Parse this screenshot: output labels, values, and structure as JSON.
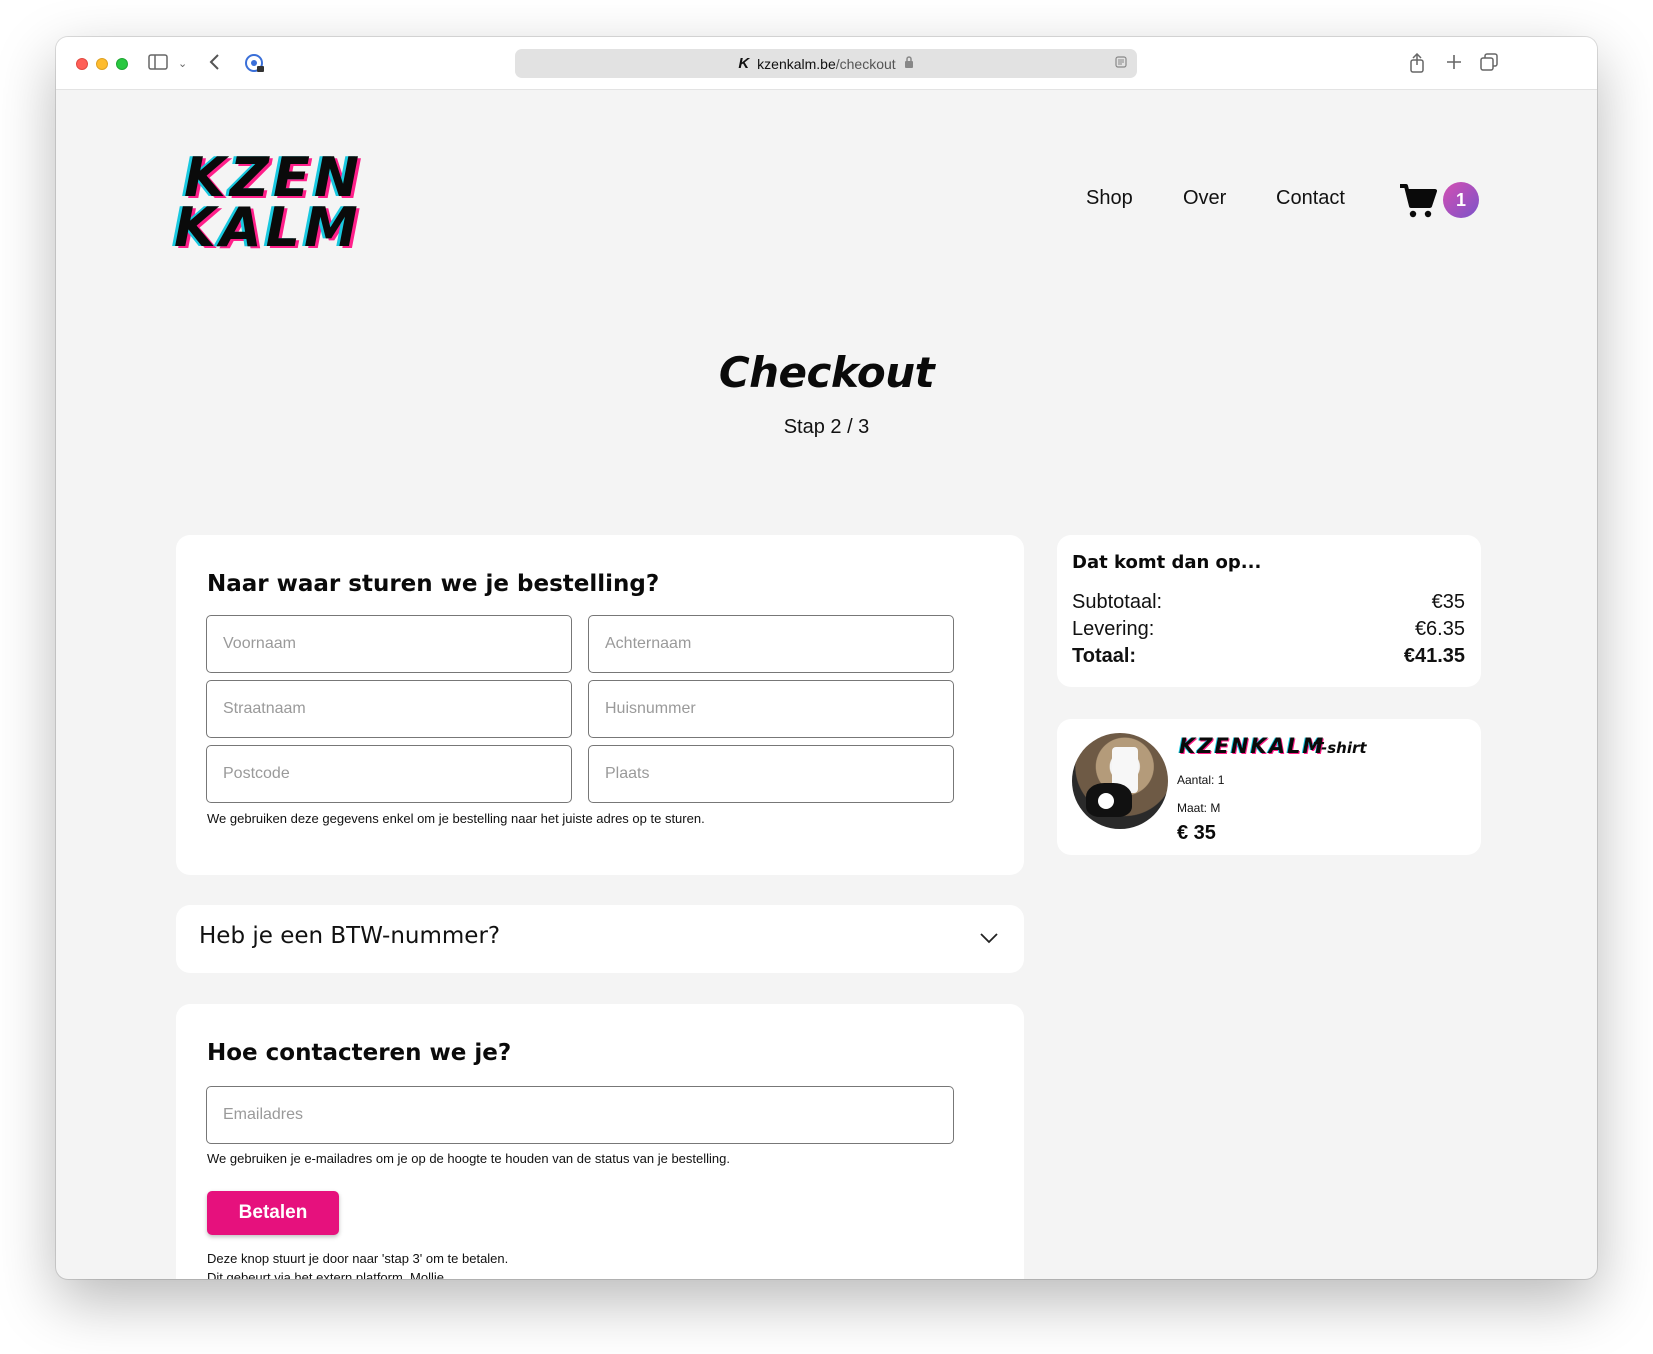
{
  "browser": {
    "domain": "kzenkalm.be",
    "path": "/checkout",
    "favicon_letter": "K"
  },
  "header": {
    "logo_line1": "KZEN",
    "logo_line2": "KALM",
    "nav": [
      "Shop",
      "Over",
      "Contact"
    ],
    "cart_count": "1"
  },
  "page": {
    "title": "Checkout",
    "step": "Stap 2 / 3"
  },
  "address": {
    "heading": "Naar waar sturen we je bestelling?",
    "fields": {
      "first_name": "Voornaam",
      "last_name": "Achternaam",
      "street": "Straatnaam",
      "house_number": "Huisnummer",
      "postcode": "Postcode",
      "city": "Plaats"
    },
    "helper": "We gebruiken deze gegevens enkel om je bestelling naar het juiste adres op te sturen."
  },
  "vat": {
    "label": "Heb je een BTW-nummer?"
  },
  "contact": {
    "heading": "Hoe contacteren we je?",
    "email_placeholder": "Emailadres",
    "helper": "We gebruiken je e-mailadres om je op de hoogte te houden van de status van je bestelling.",
    "pay_button": "Betalen",
    "note_line1": "Deze knop stuurt je door naar 'stap 3' om te betalen.",
    "note_line2": "Dit gebeurt via het extern platform, Mollie."
  },
  "summary": {
    "title": "Dat komt dan op...",
    "subtotal_label": "Subtotaal:",
    "subtotal_value": "€35",
    "delivery_label": "Levering:",
    "delivery_value": "€6.35",
    "total_label": "Totaal:",
    "total_value": "€41.35"
  },
  "product": {
    "name": "KZENKALM",
    "type": "T-shirt",
    "quantity": "Aantal: 1",
    "size": "Maat: M",
    "price": "€ 35"
  },
  "colors": {
    "accent": "#e6117d",
    "badge_start": "#d44fb2",
    "badge_end": "#7b53c9",
    "page_background": "#f4f4f4"
  }
}
